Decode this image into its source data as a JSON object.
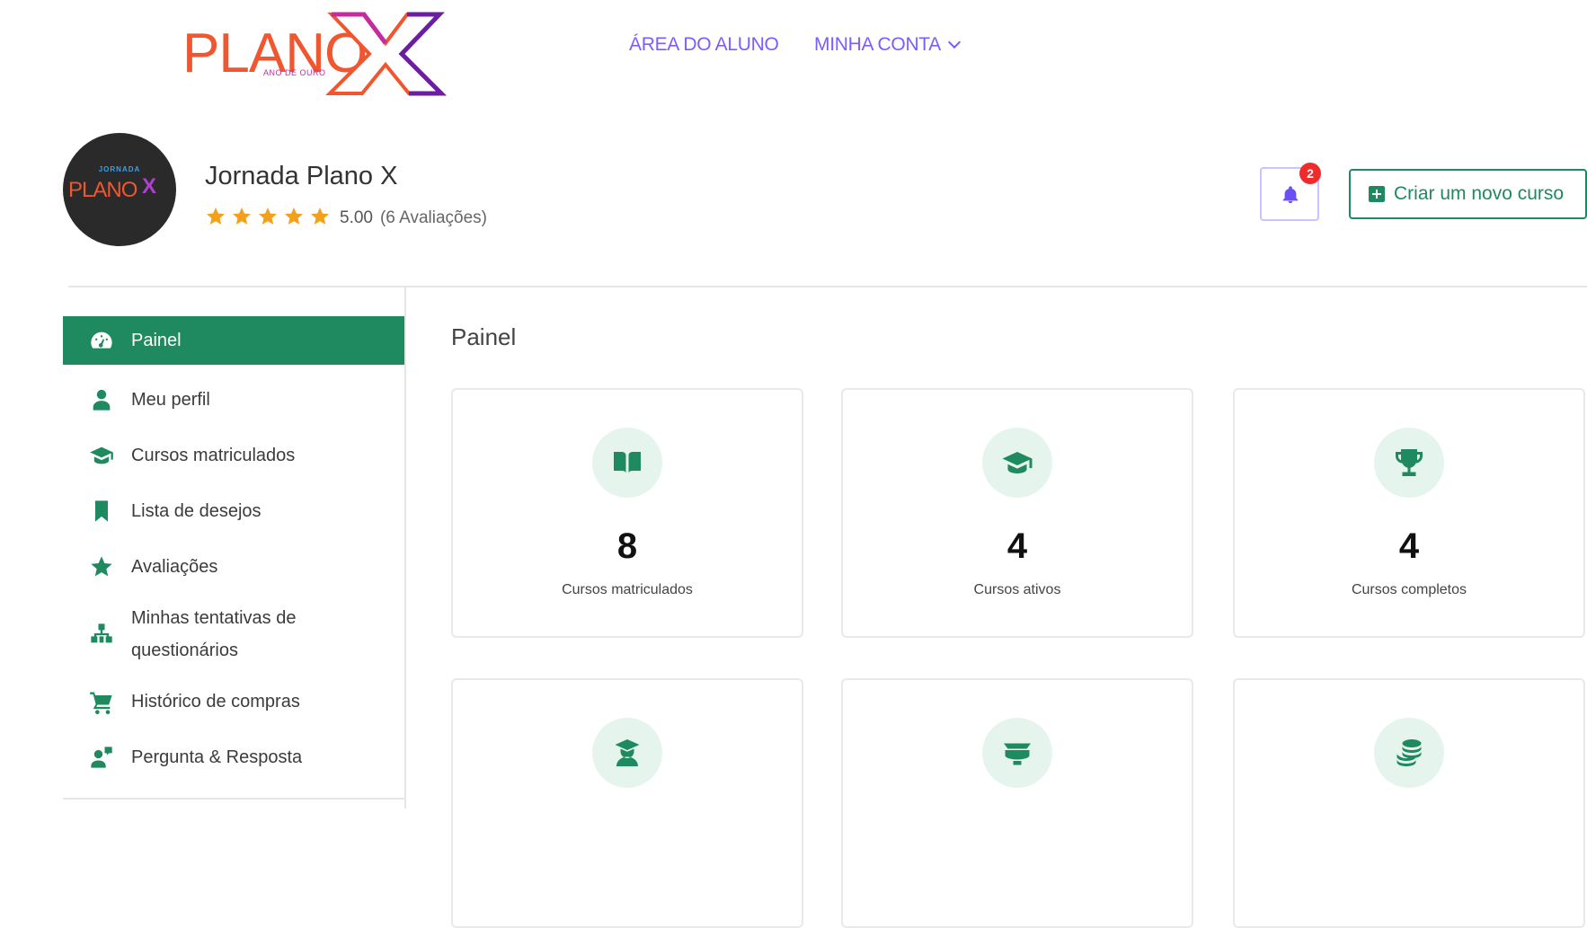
{
  "header": {
    "logo_text": "PLANO",
    "logo_mark": "X",
    "logo_tagline": "ANO DE OURO",
    "nav": [
      {
        "label": "ÁREA DO ALUNO"
      },
      {
        "label": "MINHA CONTA",
        "icon": "chevron-down-icon"
      }
    ]
  },
  "profile": {
    "avatar_top": "JORNADA",
    "avatar_main": "PLANO",
    "avatar_mark": "X",
    "name": "Jornada Plano X",
    "stars": 5,
    "rating": "5.00",
    "reviews": "(6 Avaliações)",
    "notifications_count": "2",
    "new_course_label": "Criar um novo curso"
  },
  "sidebar": {
    "items": [
      {
        "label": "Painel",
        "icon": "dashboard-icon",
        "active": true
      },
      {
        "label": "Meu perfil",
        "icon": "user-icon"
      },
      {
        "label": "Cursos matriculados",
        "icon": "graduation-cap-icon"
      },
      {
        "label": "Lista de desejos",
        "icon": "bookmark-icon"
      },
      {
        "label": "Avaliações",
        "icon": "star-icon"
      },
      {
        "label": "Minhas tentativas de questionários",
        "icon": "quiz-icon"
      },
      {
        "label": "Histórico de compras",
        "icon": "cart-icon"
      },
      {
        "label": "Pergunta & Resposta",
        "icon": "qa-icon"
      }
    ]
  },
  "main": {
    "title": "Painel",
    "cards": [
      {
        "value": "8",
        "label": "Cursos matriculados",
        "icon": "book-open-icon"
      },
      {
        "value": "4",
        "label": "Cursos ativos",
        "icon": "graduation-cap-icon"
      },
      {
        "value": "4",
        "label": "Cursos completos",
        "icon": "trophy-icon"
      },
      {
        "icon": "student-icon"
      },
      {
        "icon": "students-icon"
      },
      {
        "icon": "coins-icon"
      }
    ]
  },
  "colors": {
    "accent": "#1f8a5f",
    "nav": "#7c5cff",
    "star": "#f3a01c",
    "badge": "#ef2b2b"
  }
}
